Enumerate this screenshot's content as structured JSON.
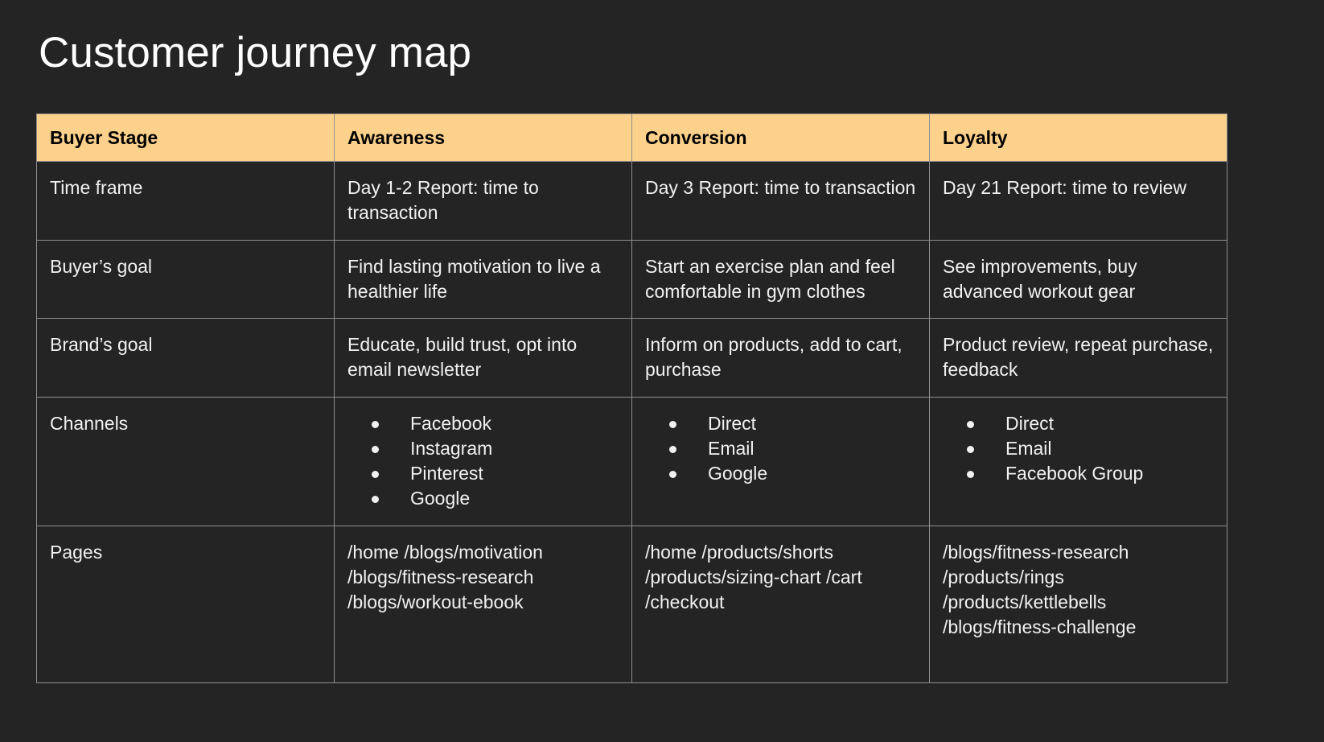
{
  "slide": {
    "title": "Customer journey map",
    "background_color": "#242424",
    "header_color": "#fcd18c",
    "text_color": "#f1f1f1",
    "border_color": "#8f8f8f"
  },
  "table": {
    "headers": [
      "Buyer Stage",
      "Awareness",
      "Conversion",
      "Loyalty"
    ],
    "rows": [
      {
        "label": "Time frame",
        "awareness": "Day 1-2\nReport: time to transaction",
        "conversion": "Day 3\nReport: time to transaction",
        "loyalty": "Day 21\nReport: time to review"
      },
      {
        "label": "Buyer’s goal",
        "awareness": "Find lasting motivation to live a healthier life",
        "conversion": "Start an exercise plan and feel comfortable in gym clothes",
        "loyalty": "See improvements, buy advanced workout gear"
      },
      {
        "label": "Brand’s goal",
        "awareness": "Educate, build trust, opt into email newsletter",
        "conversion": "Inform on products, add to cart, purchase",
        "loyalty": "Product review, repeat purchase, feedback"
      },
      {
        "label": "Channels",
        "awareness_list": [
          "Facebook",
          "Instagram",
          "Pinterest",
          "Google"
        ],
        "conversion_list": [
          "Direct",
          "Email",
          "Google"
        ],
        "loyalty_list": [
          "Direct",
          "Email",
          "Facebook Group"
        ]
      },
      {
        "label": "Pages",
        "awareness": "/home\n/blogs/motivation\n/blogs/fitness-research\n/blogs/workout-ebook",
        "conversion": "/home\n/products/shorts\n/products/sizing-chart\n/cart\n/checkout",
        "loyalty": "/blogs/fitness-research\n/products/rings\n/products/kettlebells\n/blogs/fitness-challenge"
      }
    ]
  }
}
